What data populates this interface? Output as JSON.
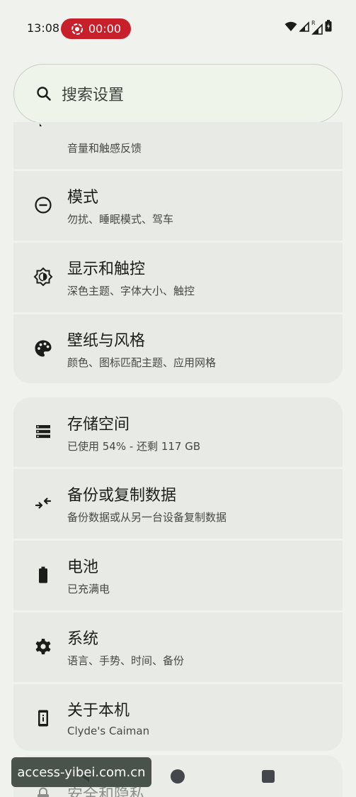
{
  "status_bar": {
    "time": "13:08",
    "recording_timer": "00:00",
    "recording_color": "#c8202b",
    "icons": [
      "wifi-icon",
      "cell-signal-icon",
      "roaming-signal-icon",
      "battery-charging-icon"
    ],
    "roaming_label": "R"
  },
  "search": {
    "placeholder": "搜索设置",
    "icon": "search-icon"
  },
  "settings_groups": [
    {
      "items": [
        {
          "title": "",
          "subtitle": "音量和触感反馈",
          "icon": "sound-icon",
          "partial": true
        },
        {
          "title": "模式",
          "subtitle": "勿扰、睡眠模式、驾车",
          "icon": "do-not-disturb-icon"
        },
        {
          "title": "显示和触控",
          "subtitle": "深色主题、字体大小、触控",
          "icon": "brightness-icon"
        },
        {
          "title": "壁纸与风格",
          "subtitle": "颜色、图标匹配主题、应用网格",
          "icon": "palette-icon"
        }
      ]
    },
    {
      "items": [
        {
          "title": "存储空间",
          "subtitle": "已使用 54% - 还剩 117 GB",
          "icon": "storage-icon"
        },
        {
          "title": "备份或复制数据",
          "subtitle": "备份数据或从另一台设备复制数据",
          "icon": "transfer-icon"
        },
        {
          "title": "电池",
          "subtitle": "已充满电",
          "icon": "battery-icon"
        },
        {
          "title": "系统",
          "subtitle": "语言、手势、时间、备份",
          "icon": "gear-icon"
        },
        {
          "title": "关于本机",
          "subtitle": "Clyde's Caiman",
          "icon": "phone-info-icon"
        }
      ]
    }
  ],
  "peek_item": {
    "title": "安全和隐私",
    "icon": "lock-icon"
  },
  "nav_bar": {
    "back": "back-icon",
    "home": "home-icon",
    "recents": "recents-icon"
  },
  "watermark": {
    "text": "access-yibei.com.cn"
  },
  "colors": {
    "background": "#f0f2ee",
    "card": "#e8ebe5",
    "search_background": "#eef4ea",
    "primary_text": "#1b1d1a",
    "secondary_text": "#454944"
  }
}
